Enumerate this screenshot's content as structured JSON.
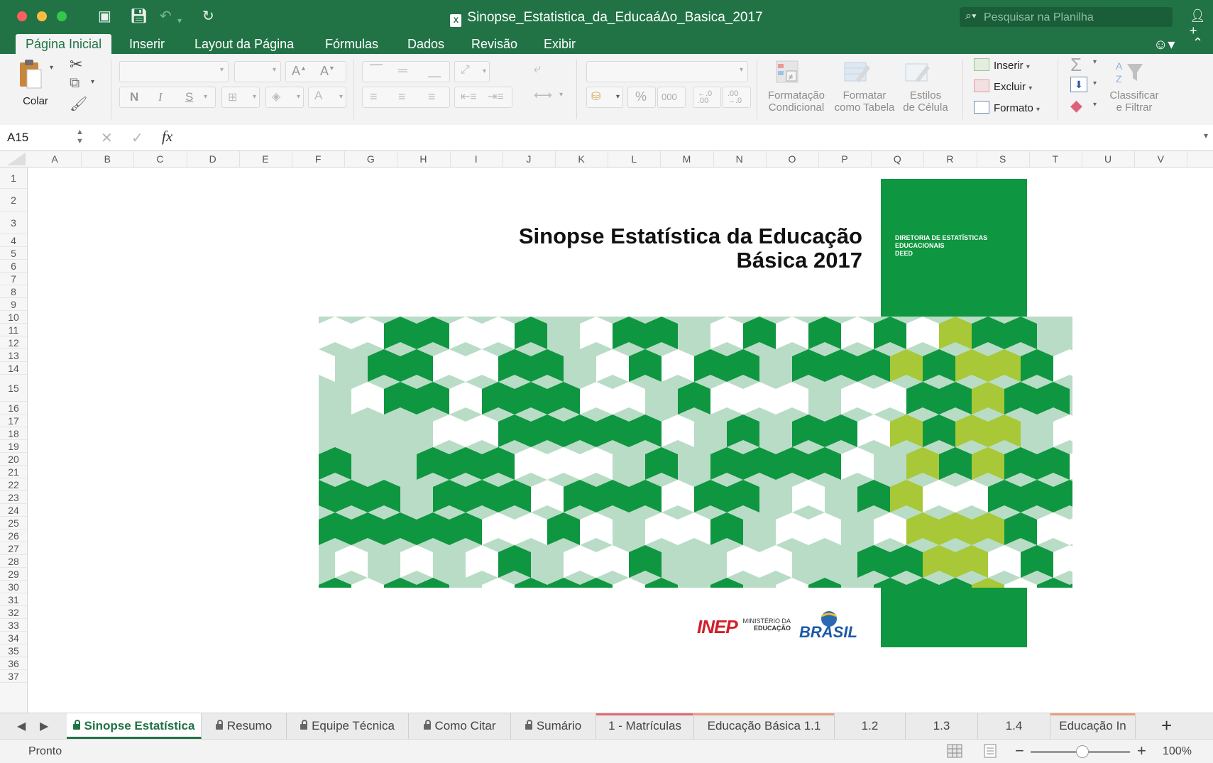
{
  "window": {
    "title": "Sinopse_Estatistica_da_EducaáΔo_Basica_2017",
    "search_placeholder": "Pesquisar na Planilha"
  },
  "ribbon_tabs": [
    "Página Inicial",
    "Inserir",
    "Layout da Página",
    "Fórmulas",
    "Dados",
    "Revisão",
    "Exibir"
  ],
  "active_ribbon_tab": "Página Inicial",
  "ribbon": {
    "paste_label": "Colar",
    "bold": "N",
    "italic": "I",
    "underline": "S",
    "grow_font": "A",
    "shrink_font": "A",
    "percent": "%",
    "thousands": "000",
    "cond_format": [
      "Formatação",
      "Condicional"
    ],
    "format_table": [
      "Formatar",
      "como Tabela"
    ],
    "cell_styles": [
      "Estilos",
      "de Célula"
    ],
    "insert": "Inserir",
    "delete": "Excluir",
    "format": "Formato",
    "sort_filter": [
      "Classificar",
      "e Filtrar"
    ]
  },
  "formula_bar": {
    "cell_ref": "A15",
    "fx": "fx",
    "value": ""
  },
  "columns": [
    "A",
    "B",
    "C",
    "D",
    "E",
    "F",
    "G",
    "H",
    "I",
    "J",
    "K",
    "L",
    "M",
    "N",
    "O",
    "P",
    "Q",
    "R",
    "S",
    "T",
    "U",
    "V"
  ],
  "rows": [
    "1",
    "2",
    "3",
    "4",
    "5",
    "6",
    "7",
    "8",
    "9",
    "10",
    "11",
    "12",
    "13",
    "14",
    "15",
    "16",
    "17",
    "18",
    "19",
    "20",
    "21",
    "22",
    "23",
    "24",
    "25",
    "26",
    "27",
    "28",
    "29",
    "30",
    "31",
    "32",
    "33",
    "34",
    "35",
    "36",
    "37"
  ],
  "cover": {
    "title_line1": "Sinopse Estatística da Educação",
    "title_line2": "Básica 2017",
    "deed_lines": [
      "DIRETORIA DE ESTATÍSTICAS",
      "EDUCACIONAIS",
      "DEED"
    ],
    "logo_inep": "INEP",
    "logo_mec_line1": "MINISTÉRIO DA",
    "logo_mec_line2": "EDUCAÇÃO",
    "logo_brasil": "BRASIL",
    "colors": {
      "dark_green": "#0f9640",
      "light_green": "#b9dcc6",
      "lime": "#a8c837",
      "red": "#d0202b"
    }
  },
  "sheet_tabs": [
    {
      "label": "Sinopse Estatística",
      "locked": true,
      "active": true
    },
    {
      "label": "Resumo",
      "locked": true
    },
    {
      "label": "Equipe Técnica",
      "locked": true
    },
    {
      "label": "Como Citar",
      "locked": true
    },
    {
      "label": "Sumário",
      "locked": true
    },
    {
      "label": "1 - Matrículas",
      "locked": false,
      "color": "#e06a73"
    },
    {
      "label": "Educação Básica 1.1",
      "locked": false,
      "color": "#e8a080"
    },
    {
      "label": "1.2",
      "locked": false
    },
    {
      "label": "1.3",
      "locked": false
    },
    {
      "label": "1.4",
      "locked": false
    },
    {
      "label": "Educação In",
      "locked": false,
      "color": "#e8a080"
    }
  ],
  "status": {
    "ready": "Pronto",
    "zoom": "100%",
    "zoom_value": 100
  },
  "accent_color": "#217346"
}
